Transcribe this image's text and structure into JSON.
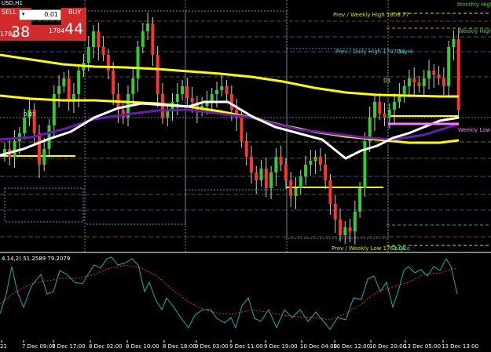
{
  "window": {
    "symbol_timeframe": "USD,H1"
  },
  "trade_panel": {
    "sell_label": "SELL",
    "buy_label": "BUY",
    "lot_value": "0.01",
    "sell_price_small": "1784",
    "sell_price_big": "38",
    "buy_price_small": "1784",
    "buy_price_big": "44",
    "dropdown_icon": "triangle-down-icon"
  },
  "chart_labels": {
    "monthly_high": "Monthly High",
    "prev_weekly_high": "Prev / Weekly High 1808.77",
    "weekly_high": "Weekly High",
    "prev_daily_high": "Prev / Daily High 1797.50",
    "day_hi": "DayHi",
    "d1": "D1",
    "weekly_low": "Weekly Low",
    "prev_weekly_low": "Prev / Weekly Low 1761.08",
    "day_lo": "DayLo",
    "order_level": "0.01"
  },
  "indicator": {
    "header": "4.14,2) 51.2589 79.2079"
  },
  "time_axis": [
    "21",
    "7 Dec 09:00",
    "7 Dec 17:00",
    "8 Dec 02:00",
    "8 Dec 10:00",
    "8 Dec 18:00",
    "9 Dec 03:00",
    "9 Dec 11:00",
    "9 Dec 19:00",
    "10 Dec 04:00",
    "10 Dec 12:00",
    "10 Dec 20:00",
    "13 Dec 05:00",
    "13 Dec 13:00"
  ],
  "colors": {
    "background": "#000000",
    "bull_candle": "#33cc33",
    "bear_candle": "#ff3333",
    "yellow_ma": "#ffff00",
    "white_ma": "#ffffff",
    "purple_ma": "#6a1bb0",
    "stoch_main": "#22aaaa",
    "stoch_signal": "#dd3333",
    "panel_red": "#d12b2b"
  }
}
